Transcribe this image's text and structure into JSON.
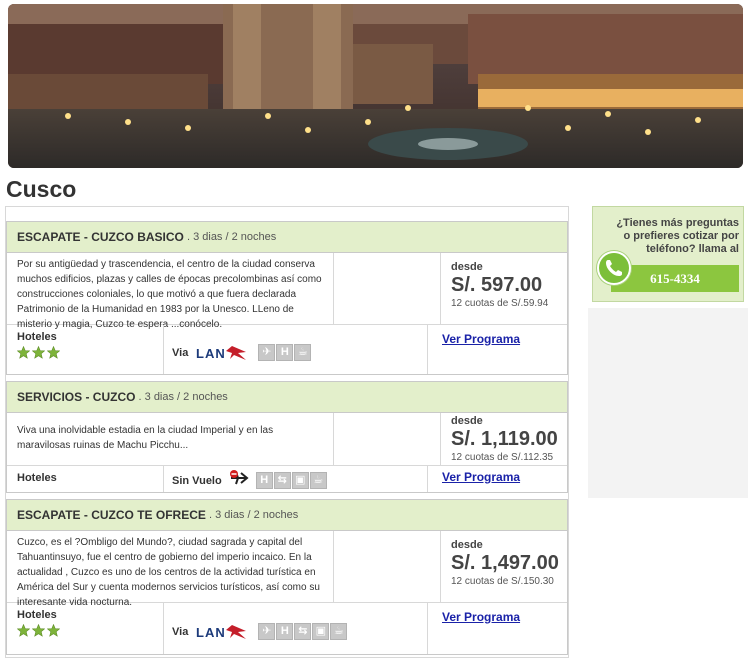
{
  "page": {
    "title": "Cusco"
  },
  "packages": [
    {
      "name": "ESCAPATE - CUZCO BASICO",
      "duration": "3 dias / 2 noches",
      "description": "Por su antigüedad y trascendencia, el centro de la ciudad conserva muchos edificios, plazas y calles de épocas precolombinas así como construcciones coloniales, lo que motivó a que fuera declarada Patrimonio de la Humanidad en 1983 por la Unesco. LLeno de misterio y magia, Cuzco te espera ...conócelo.",
      "from_label": "desde",
      "price": "S/. 597.00",
      "installments": "12 cuotas de S/.59.94",
      "hotel_label": "Hoteles",
      "hotel_stars": 3,
      "flight_label": "Via",
      "airline": "LAN",
      "services": [
        "plane-icon",
        "hotel-icon",
        "coffee-icon"
      ],
      "link": "Ver Programa"
    },
    {
      "name": "SERVICIOS - CUZCO",
      "duration": "3 dias / 2 noches",
      "description": "Viva una inolvidable estadia en la ciudad Imperial y en las maravilosas ruinas de Machu Picchu...",
      "from_label": "desde",
      "price": "S/. 1,119.00",
      "installments": "12 cuotas de S/.112.35",
      "hotel_label": "Hoteles",
      "hotel_stars": 0,
      "flight_label": "Sin Vuelo",
      "airline": "",
      "services": [
        "hotel-icon",
        "transfer-icon",
        "tour-icon",
        "coffee-icon"
      ],
      "link": "Ver Programa"
    },
    {
      "name": "ESCAPATE - CUZCO TE OFRECE",
      "duration": "3 dias / 2 noches",
      "description": "Cuzco, es el ?Ombligo del Mundo?, ciudad sagrada y capital del Tahuantinsuyo, fue el centro de gobierno del imperio incaico. En la actualidad , Cuzco es uno de los centros de la actividad turística en América del Sur y cuenta modernos servicios turísticos, así como su interesante vida nocturna.",
      "from_label": "desde",
      "price": "S/. 1,497.00",
      "installments": "12 cuotas de S/.150.30",
      "hotel_label": "Hoteles",
      "hotel_stars": 3,
      "flight_label": "Via",
      "airline": "LAN",
      "services": [
        "plane-icon",
        "hotel-icon",
        "transfer-icon",
        "tour-icon",
        "coffee-icon"
      ],
      "link": "Ver Programa"
    }
  ],
  "sidebar": {
    "question": "¿Tienes más preguntas o prefieres cotizar por teléfono? llama al",
    "phone": "615-4334"
  },
  "colors": {
    "header_green": "#e3efcb",
    "accent_green": "#8cc63f",
    "link_blue": "#1a22a8",
    "star_green": "#7db33a"
  }
}
